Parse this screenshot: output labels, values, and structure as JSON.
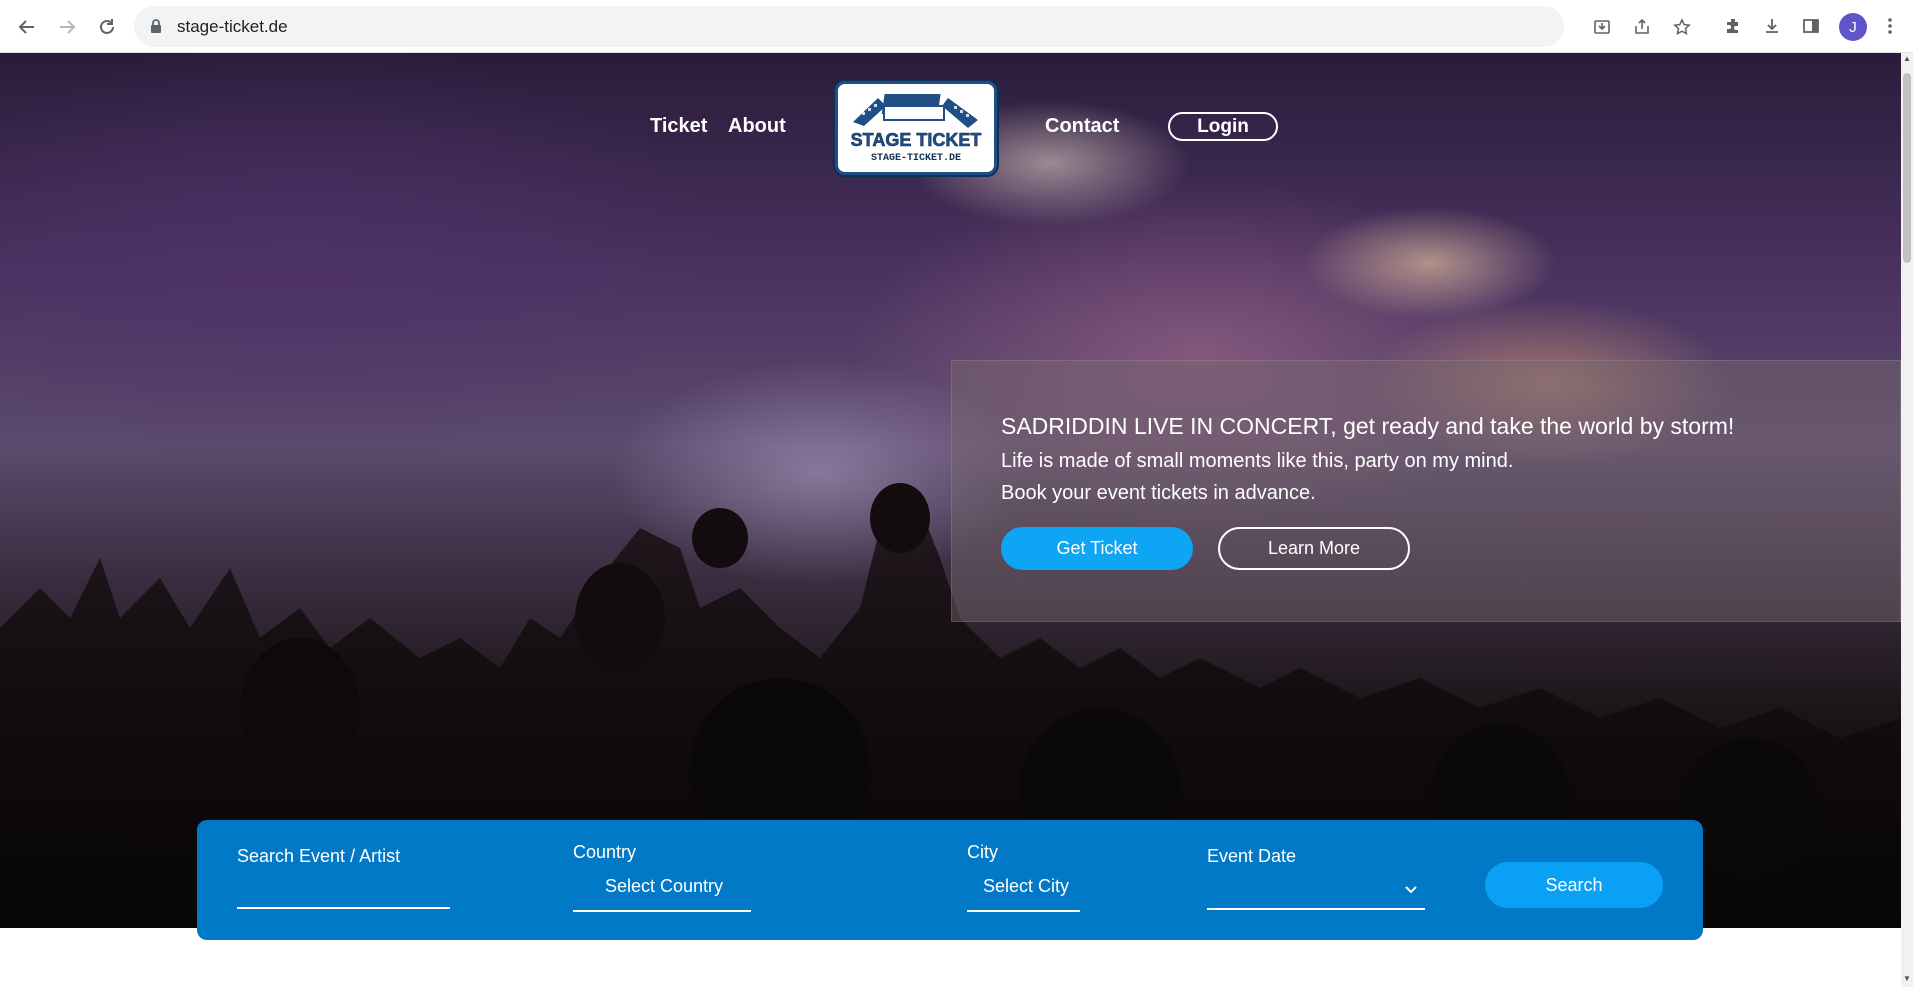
{
  "browser": {
    "url": "stage-ticket.de",
    "avatar_letter": "J"
  },
  "site_nav": {
    "ticket": "Ticket",
    "about": "About",
    "contact": "Contact",
    "login": "Login",
    "logo_title": "STAGE TICKET",
    "logo_subtitle": "STAGE-TICKET.DE"
  },
  "promo": {
    "title": "SADRIDDIN LIVE IN CONCERT, get ready and take the world by storm!",
    "line1": "Life is made of small moments like this, party on my mind.",
    "line2": "Book your event tickets in advance.",
    "primary_button": "Get Ticket",
    "secondary_button": "Learn More"
  },
  "search": {
    "event_label": "Search Event / Artist",
    "country_label": "Country",
    "country_value": "Select Country",
    "city_label": "City",
    "city_value": "Select City",
    "date_label": "Event Date",
    "button": "Search"
  },
  "colors": {
    "accent_blue": "#0279c7",
    "button_blue": "#0ea5f4"
  }
}
